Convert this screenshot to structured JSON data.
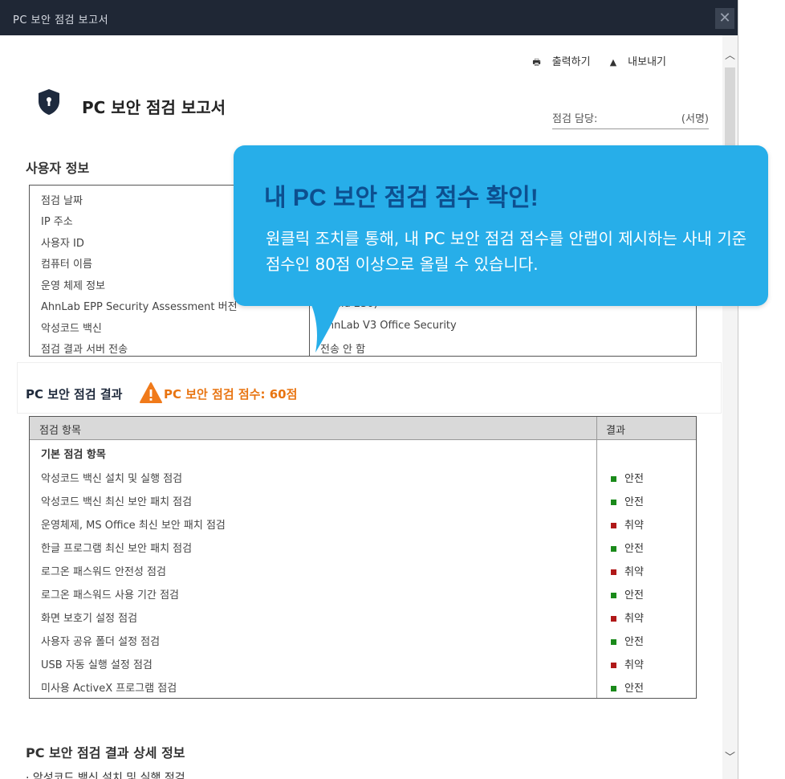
{
  "window": {
    "title": "PC 보안 점검 보고서",
    "close_label": "✕"
  },
  "toolbar": {
    "print_label": "출력하기",
    "export_label": "내보내기",
    "print_icon": "printer-icon",
    "export_icon": "upload-icon"
  },
  "report": {
    "title": "PC 보안 점검 보고서",
    "inspector_label": "점검 담당:",
    "signature_placeholder": "(서명)"
  },
  "user_info": {
    "title": "사용자 정보",
    "rows": [
      {
        "label": "점검 날짜",
        "value": ""
      },
      {
        "label": "IP 주소",
        "value": ""
      },
      {
        "label": "사용자 ID",
        "value": ""
      },
      {
        "label": "컴퓨터 이름",
        "value": ""
      },
      {
        "label": "운영 체제 정보",
        "value": ""
      },
      {
        "label": "AhnLab EPP Security Assessment 버전",
        "value": "(Build 230)"
      },
      {
        "label": "악성코드 백신",
        "value": "AhnLab V3 Office Security"
      },
      {
        "label": "점검 결과 서버 전송",
        "value": "전송 안 함"
      }
    ]
  },
  "result": {
    "title": "PC 보안 점검 결과",
    "score_text": "PC 보안 점검 점수: 60점",
    "warning_icon": "warning-icon"
  },
  "check_table": {
    "col_item": "점검 항목",
    "col_result": "결과",
    "group": "기본 점검 항목",
    "colors": {
      "safe": "#1a8a1a",
      "vulnerable": "#b01818"
    },
    "rows": [
      {
        "item": "악성코드 백신 설치 및 실행 점검",
        "result": "안전",
        "status": "safe"
      },
      {
        "item": "악성코드 백신 최신 보안 패치 점검",
        "result": "안전",
        "status": "safe"
      },
      {
        "item": "운영체제, MS Office 최신 보안 패치 점검",
        "result": "취약",
        "status": "vulnerable"
      },
      {
        "item": "한글 프로그램 최신 보안 패치 점검",
        "result": "안전",
        "status": "safe"
      },
      {
        "item": "로그온 패스워드 안전성 점검",
        "result": "취약",
        "status": "vulnerable"
      },
      {
        "item": "로그온 패스워드 사용 기간 점검",
        "result": "안전",
        "status": "safe"
      },
      {
        "item": "화면 보호기 설정 점검",
        "result": "취약",
        "status": "vulnerable"
      },
      {
        "item": "사용자 공유 폴더 설정 점검",
        "result": "안전",
        "status": "safe"
      },
      {
        "item": "USB 자동 실행 설정 점검",
        "result": "취약",
        "status": "vulnerable"
      },
      {
        "item": "미사용 ActiveX 프로그램 점검",
        "result": "안전",
        "status": "safe"
      }
    ]
  },
  "detail": {
    "title": "PC 보안 점검 결과 상세 정보",
    "first_item": "· 악성코드 백신 설치 및 실행 점검"
  },
  "callout": {
    "headline": "내 PC 보안 점검 점수 확인!",
    "body": "원클릭 조치를 통해, 내 PC 보안 점검 점수를 안랩이 제시하는 사내 기준 점수인 80점 이상으로 올릴 수 있습니다.",
    "bg_color": "#27aee9",
    "headline_color": "#0d4f8f"
  },
  "scrollbar": {
    "up": "︿",
    "down": "﹀"
  }
}
